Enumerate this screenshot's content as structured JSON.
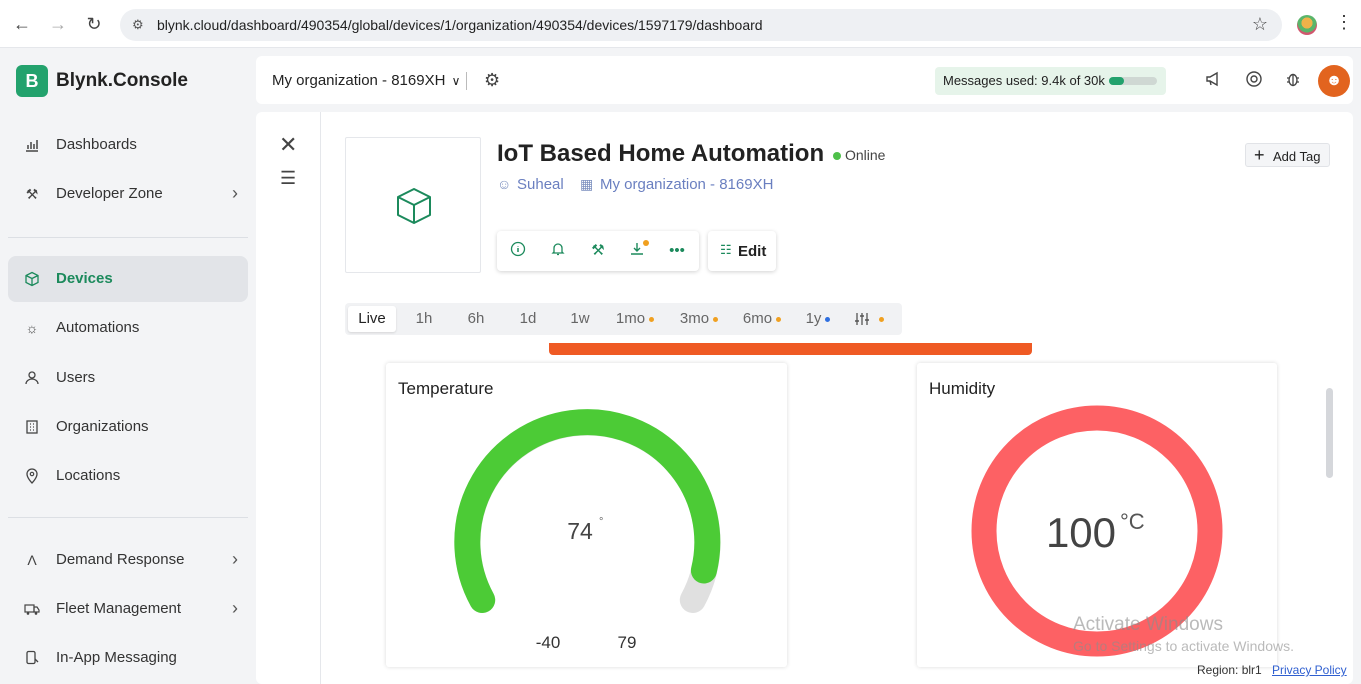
{
  "browser": {
    "url": "blynk.cloud/dashboard/490354/global/devices/1/organization/490354/devices/1597179/dashboard"
  },
  "sidebar": {
    "logo_letter": "B",
    "logo_text": "Blynk.Console",
    "items": [
      {
        "label": "Dashboards",
        "icon": "chart-icon"
      },
      {
        "label": "Developer Zone",
        "icon": "tools-icon",
        "has_chevron": true
      },
      {
        "label": "Devices",
        "icon": "cube-icon",
        "active": true
      },
      {
        "label": "Automations",
        "icon": "sun-icon"
      },
      {
        "label": "Users",
        "icon": "user-icon"
      },
      {
        "label": "Organizations",
        "icon": "building-icon"
      },
      {
        "label": "Locations",
        "icon": "pin-icon"
      },
      {
        "label": "Demand Response",
        "icon": "signal-icon",
        "has_chevron": true
      },
      {
        "label": "Fleet Management",
        "icon": "truck-icon",
        "has_chevron": true
      },
      {
        "label": "In-App Messaging",
        "icon": "message-icon"
      }
    ]
  },
  "header": {
    "org_name": "My organization - 8169XH",
    "messages_label": "Messages used: 9.4k of 30k",
    "messages_fraction": 0.31
  },
  "device": {
    "title": "IoT Based Home Automation",
    "status": "Online",
    "owner": "Suheal",
    "organization": "My organization - 8169XH",
    "edit_label": "Edit",
    "add_tag_label": "Add Tag"
  },
  "time_ranges": [
    {
      "label": "Live",
      "active": true
    },
    {
      "label": "1h"
    },
    {
      "label": "6h"
    },
    {
      "label": "1d"
    },
    {
      "label": "1w"
    },
    {
      "label": "1mo",
      "dot": "#f0a020"
    },
    {
      "label": "3mo",
      "dot": "#f0a020"
    },
    {
      "label": "6mo",
      "dot": "#f0a020"
    },
    {
      "label": "1y",
      "dot": "#2f6fe0"
    }
  ],
  "widgets": {
    "temperature": {
      "title": "Temperature",
      "value": "74",
      "unit": "°",
      "min": "-40",
      "max": "79",
      "color": "#4ccb36"
    },
    "humidity": {
      "title": "Humidity",
      "value": "100",
      "unit": "°C",
      "color": "#fd6164"
    }
  },
  "watermark": {
    "line1": "Activate Windows",
    "line2": "Go to Settings to activate Windows."
  },
  "footer": {
    "region": "Region: blr1",
    "privacy": "Privacy Policy"
  },
  "colors": {
    "brand": "#23a26d",
    "accent_orange": "#ef5a24"
  }
}
